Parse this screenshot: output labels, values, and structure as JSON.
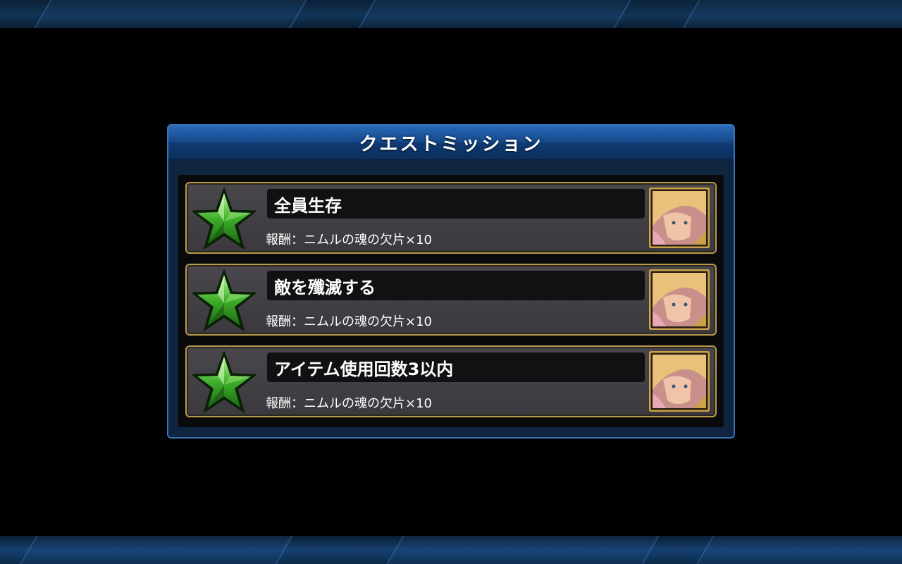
{
  "dialog": {
    "title": "クエストミッション"
  },
  "missions": [
    {
      "title": "全員生存",
      "reward": "報酬：ニムルの魂の欠片×10",
      "status": "cleared",
      "icon": "green-star-icon"
    },
    {
      "title": "敵を殲滅する",
      "reward": "報酬：ニムルの魂の欠片×10",
      "status": "cleared",
      "icon": "green-star-icon"
    },
    {
      "title": "アイテム使用回数3以内",
      "reward": "報酬：ニムルの魂の欠片×10",
      "status": "cleared",
      "icon": "green-star-icon"
    }
  ],
  "colors": {
    "star": "#3fae2a",
    "frame_gold": "#b89a4c",
    "header_blue": "#174b8e"
  }
}
